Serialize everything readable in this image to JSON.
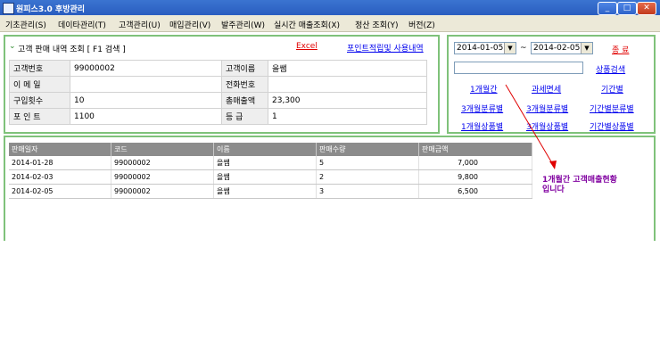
{
  "window": {
    "title": "원피스3.0 후방관리",
    "min": "_",
    "max": "□",
    "close": "✕"
  },
  "menu": [
    "기초관리(S)",
    "데이타관리(T)",
    "고객관리(U)",
    "매입관리(V)",
    "발주관리(W)",
    "실시간 매출조회(X)",
    "정산 조회(Y)",
    "버전(Z)"
  ],
  "panel": {
    "title": "고객 판매 내역 조회  [ F1 검색 ]",
    "excel": "Excel",
    "points_link": "포인트적립및 사용내역"
  },
  "customer": {
    "id_label": "고객번호",
    "id_value": "99000002",
    "name_label": "고객이름",
    "name_value": "을쌤",
    "email_label": "이 메 일",
    "email_value": "",
    "phone_label": "전화번호",
    "phone_value": "",
    "count_label": "구입횟수",
    "count_value": "10",
    "total_label": "총매출액",
    "total_value": "23,300",
    "point_label": "포 인 트",
    "point_value": "1100",
    "grade_label": "등    급",
    "grade_value": "1"
  },
  "filter": {
    "date_from": "2014-01-05",
    "tilde": "~",
    "date_to": "2014-02-05",
    "close_label": "종 료",
    "product_search": "상품검색",
    "btn_1month": "1개월간",
    "btn_tax": "과세면세",
    "btn_period": "기간별",
    "btn_3m_cat": "3개월분류별",
    "btn_3m_cat2": "3개월분류별",
    "btn_period_cat": "기간별분류별",
    "btn_1m_prod": "1개월상품별",
    "btn_3m_prod": "3개월상품별",
    "btn_period_prod": "기간별상품별"
  },
  "grid": {
    "headers": [
      "판매일자",
      "코드",
      "이름",
      "판매수량",
      "판매금액"
    ],
    "rows": [
      [
        "2014-01-28",
        "99000002",
        "을쌤",
        "5",
        "7,000"
      ],
      [
        "2014-02-03",
        "99000002",
        "을쌤",
        "2",
        "9,800"
      ],
      [
        "2014-02-05",
        "99000002",
        "을쌤",
        "3",
        "6,500"
      ]
    ]
  },
  "annotation": {
    "line1": "1개월간 고객매출현황",
    "line2": "입니다"
  },
  "colors": {
    "panel_border": "#7fc27a",
    "link": "#0000ee",
    "annotation": "#8000a0",
    "arrow": "#e00000"
  }
}
